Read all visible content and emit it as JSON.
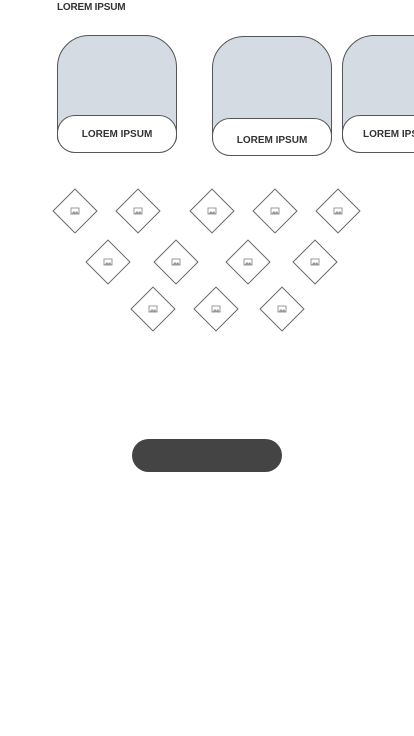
{
  "header": {
    "title": "LOREM IPSUM"
  },
  "cards": [
    {
      "label": "LOREM IPSUM"
    },
    {
      "label": "LOREM IPSUM"
    },
    {
      "label": "LOREM IPSUM"
    }
  ],
  "tiles": {
    "count": 12,
    "icon": "image-placeholder-icon"
  },
  "action_button": {
    "label": ""
  },
  "colors": {
    "card_fill": "#d5dbe3",
    "outline": "#555555",
    "button": "#444444",
    "background": "#ffffff"
  }
}
